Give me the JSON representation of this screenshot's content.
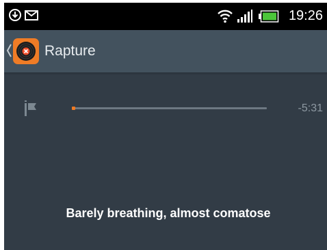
{
  "status_bar": {
    "time": "19:26",
    "icons": [
      "download-icon",
      "mail-icon",
      "wifi-icon",
      "signal-icon",
      "battery-icon"
    ]
  },
  "action_bar": {
    "title": "Rapture",
    "logo_icon": "vinyl-record-icon"
  },
  "player": {
    "time_remaining": "-5:31",
    "progress": 0.01,
    "flag_icon": "flag-icon",
    "lyric": "Barely breathing, almost comatose"
  },
  "colors": {
    "accent": "#f07a22",
    "background": "#323c46",
    "action_bar": "#43525e",
    "status_bar": "#000000"
  }
}
